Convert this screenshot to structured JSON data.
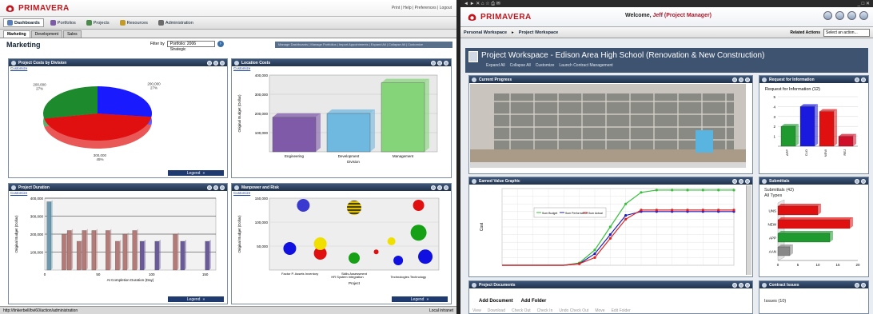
{
  "left": {
    "app": {
      "logo": "PRIMAVERA",
      "top_links": "Print | Help | Preferences | Logout"
    },
    "nav": [
      {
        "label": "Dashboards",
        "icon": "dashboard-icon",
        "color": "#5a7fb8",
        "active": true
      },
      {
        "label": "Portfolios",
        "icon": "portfolio-icon",
        "color": "#7b5aa6"
      },
      {
        "label": "Projects",
        "icon": "projects-icon",
        "color": "#4b8a4b"
      },
      {
        "label": "Resources",
        "icon": "resources-icon",
        "color": "#c29a2a"
      },
      {
        "label": "Administration",
        "icon": "administration-icon",
        "color": "#6a6a6a"
      }
    ],
    "tabs": [
      {
        "label": "Marketing",
        "active": true
      },
      {
        "label": "Development"
      },
      {
        "label": "Sales"
      }
    ],
    "page_title": "Marketing",
    "filter": {
      "label": "Filter by",
      "value": "Portfolio: 2006 Strategic"
    },
    "manage_links": "Manage Dashboards | Manage Portfolios | Import Appointments | Expand All | Collapse All | Customize",
    "portlets": {
      "costs": {
        "title": "Project Costs by Division",
        "customize": "Customize",
        "legend": "Legend"
      },
      "location": {
        "title": "Location Costs",
        "customize": "Customize"
      },
      "duration": {
        "title": "Project Duration",
        "customize": "Customize",
        "legend": "Legend"
      },
      "manpower": {
        "title": "Manpower and Risk",
        "customize": "Customize",
        "legend": "Legend"
      }
    },
    "status": {
      "url": "http://tinkerbell/bvi60/action/administration",
      "zone": "Local intranet"
    }
  },
  "right": {
    "app": {
      "logo": "PRIMAVERA",
      "welcome_prefix": "Welcome, ",
      "user": "Jeff (Project Manager)"
    },
    "nav": {
      "personal": "Personal Workspace",
      "project": "Project Workspace",
      "related": "Related Actions",
      "select": "Select an action..."
    },
    "workspace": {
      "title": "Project Workspace - Edison Area High School (Renovation & New Construction)",
      "links": [
        "Expand All",
        "Collapse All",
        "Customize",
        "Launch Contract Management"
      ]
    },
    "portlets": {
      "progress": {
        "title": "Current Progress"
      },
      "rfi": {
        "title": "Request for Information",
        "chart_title": "Request for Information (12)"
      },
      "ev": {
        "title": "Earned Value Graphic",
        "ylabel": "Cost"
      },
      "submittals": {
        "title": "Submittals",
        "count": "Submittals (42)",
        "types": "All Types"
      },
      "docs": {
        "title": "Project Documents",
        "actions": [
          "Add Document",
          "Add Folder"
        ],
        "buttons": [
          "View",
          "Download",
          "Check Out",
          "Check In",
          "Undo Check Out",
          "Move",
          "Edit Folder"
        ]
      },
      "contract": {
        "title": "Contract Issues",
        "issues": "Issues (10)"
      }
    }
  },
  "chart_data": [
    {
      "type": "pie",
      "title": "Project Costs by Division",
      "slices": [
        {
          "label": "200,000",
          "pct": "27%",
          "value": 27,
          "color": "#1a1aff"
        },
        {
          "label": "300,000",
          "pct": "45%",
          "value": 45,
          "color": "#e01010"
        },
        {
          "label": "200,000",
          "pct": "27%",
          "value": 28,
          "color": "#1e8a2e"
        }
      ],
      "series_names": [],
      "slice_label_texts": [
        "200,000\n27%",
        "300,000\n45%",
        "200,000\n27%"
      ]
    },
    {
      "type": "bar",
      "title": "Location Costs",
      "categories": [
        "Engineering",
        "Development",
        "Management"
      ],
      "values": [
        180000,
        200000,
        360000
      ],
      "colors": [
        "#7e5aa8",
        "#6fb8e0",
        "#86d47a"
      ],
      "xlabel": "Division",
      "ylabel": "Original Budget (Dollar)",
      "yticks": [
        "400,000",
        "300,000",
        "200,000",
        "100,000"
      ],
      "ylim": [
        0,
        400000
      ]
    },
    {
      "type": "bar",
      "title": "Project Duration",
      "xlabel": "At Completion Duration (Day)",
      "ylabel": "Original Budget (Dollar)",
      "yticks": [
        "400,000",
        "300,000",
        "200,000",
        "100,000"
      ],
      "xticks": [
        "0",
        "50",
        "100",
        "150"
      ],
      "xlim": [
        0,
        160
      ],
      "ylim": [
        0,
        400000
      ],
      "points": [
        {
          "x": 2,
          "y": 380000,
          "color": "#6b9ab0"
        },
        {
          "x": 16,
          "y": 200000,
          "color": "#b37a78"
        },
        {
          "x": 21,
          "y": 220000,
          "color": "#b37a78"
        },
        {
          "x": 30,
          "y": 160000,
          "color": "#b37a78"
        },
        {
          "x": 35,
          "y": 220000,
          "color": "#b37a78"
        },
        {
          "x": 44,
          "y": 220000,
          "color": "#b37a78"
        },
        {
          "x": 57,
          "y": 220000,
          "color": "#b37a78"
        },
        {
          "x": 66,
          "y": 160000,
          "color": "#b37a78"
        },
        {
          "x": 73,
          "y": 200000,
          "color": "#b37a78"
        },
        {
          "x": 82,
          "y": 220000,
          "color": "#b37a78"
        },
        {
          "x": 89,
          "y": 160000,
          "color": "#6a5a9a"
        },
        {
          "x": 103,
          "y": 160000,
          "color": "#6a5a9a"
        },
        {
          "x": 120,
          "y": 200000,
          "color": "#b37a78"
        },
        {
          "x": 127,
          "y": 160000,
          "color": "#6a5a9a"
        },
        {
          "x": 150,
          "y": 160000,
          "color": "#6a5a9a"
        }
      ]
    },
    {
      "type": "scatter",
      "title": "Manpower and Risk",
      "ylabel": "Original Budget (Dollar)",
      "xlabel": "Project",
      "yticks": [
        "150,000",
        "100,000",
        "50,000"
      ],
      "xcats": [
        "Factor P. Assets Inventory",
        "HR System Integration",
        "Skills Assessment",
        "Technologies Technology"
      ],
      "ylim": [
        0,
        150000
      ],
      "points": [
        {
          "x": 0.12,
          "y": 45000,
          "r": 8,
          "color": "#1010e0"
        },
        {
          "x": 0.2,
          "y": 135000,
          "r": 8,
          "color": "#3a3ad0"
        },
        {
          "x": 0.3,
          "y": 35000,
          "r": 8,
          "color": "#e01010"
        },
        {
          "x": 0.3,
          "y": 55000,
          "r": 8,
          "color": "#f0e000"
        },
        {
          "x": 0.5,
          "y": 130000,
          "r": 9,
          "color": "#e0c000",
          "pattern": true
        },
        {
          "x": 0.5,
          "y": 25000,
          "r": 7,
          "color": "#16a016"
        },
        {
          "x": 0.63,
          "y": 38000,
          "r": 3,
          "color": "#e01010"
        },
        {
          "x": 0.72,
          "y": 60000,
          "r": 5,
          "color": "#f0e000"
        },
        {
          "x": 0.76,
          "y": 20000,
          "r": 6,
          "color": "#1010e0"
        },
        {
          "x": 0.88,
          "y": 135000,
          "r": 7,
          "color": "#e01010"
        },
        {
          "x": 0.88,
          "y": 78000,
          "r": 10,
          "color": "#16a016"
        },
        {
          "x": 0.92,
          "y": 28000,
          "r": 9,
          "color": "#1010e0"
        }
      ]
    },
    {
      "type": "bar",
      "title": "Request for Information (12)",
      "categories": [
        "APP",
        "CLO",
        "NEW",
        "REJ"
      ],
      "values": [
        2,
        4,
        3.5,
        1
      ],
      "colors": [
        "#1e9a2e",
        "#1a1adf",
        "#e01010",
        "#d0102a"
      ],
      "ylim": [
        0,
        5
      ],
      "yticks": [
        "5",
        "4",
        "3",
        "2",
        "1"
      ]
    },
    {
      "type": "line",
      "title": "Earned Value Graphic",
      "ylabel": "Cost",
      "series": [
        {
          "name": "Sum Budget",
          "color": "#36c03a",
          "values": [
            0,
            0,
            0,
            0,
            0,
            0.3,
            2,
            5,
            8,
            9.5,
            9.8,
            9.8,
            9.8,
            9.8,
            9.8,
            9.8
          ]
        },
        {
          "name": "Sum Performance",
          "color": "#1c1cc0",
          "values": [
            0,
            0,
            0,
            0,
            0,
            0.2,
            1.5,
            4,
            6.5,
            7,
            7,
            7,
            7,
            7,
            7,
            7
          ]
        },
        {
          "name": "Sum Actual",
          "color": "#e02020",
          "values": [
            0,
            0,
            0,
            0,
            0,
            0.2,
            1,
            3.5,
            6,
            7.2,
            7.2,
            7.2,
            7.2,
            7.2,
            7.2,
            7.2
          ]
        }
      ],
      "ylim": [
        0,
        10
      ]
    },
    {
      "type": "bar",
      "title": "Submittals (42)",
      "categories": [
        "UNS",
        "NEW",
        "APP",
        "AAN"
      ],
      "values": [
        10,
        18,
        13,
        3
      ],
      "colors": [
        "#e01010",
        "#e01010",
        "#1e9a2e",
        "#888888"
      ],
      "xticks": [
        "0",
        "5",
        "10",
        "15",
        "20"
      ],
      "xlim": [
        0,
        20
      ]
    }
  ]
}
